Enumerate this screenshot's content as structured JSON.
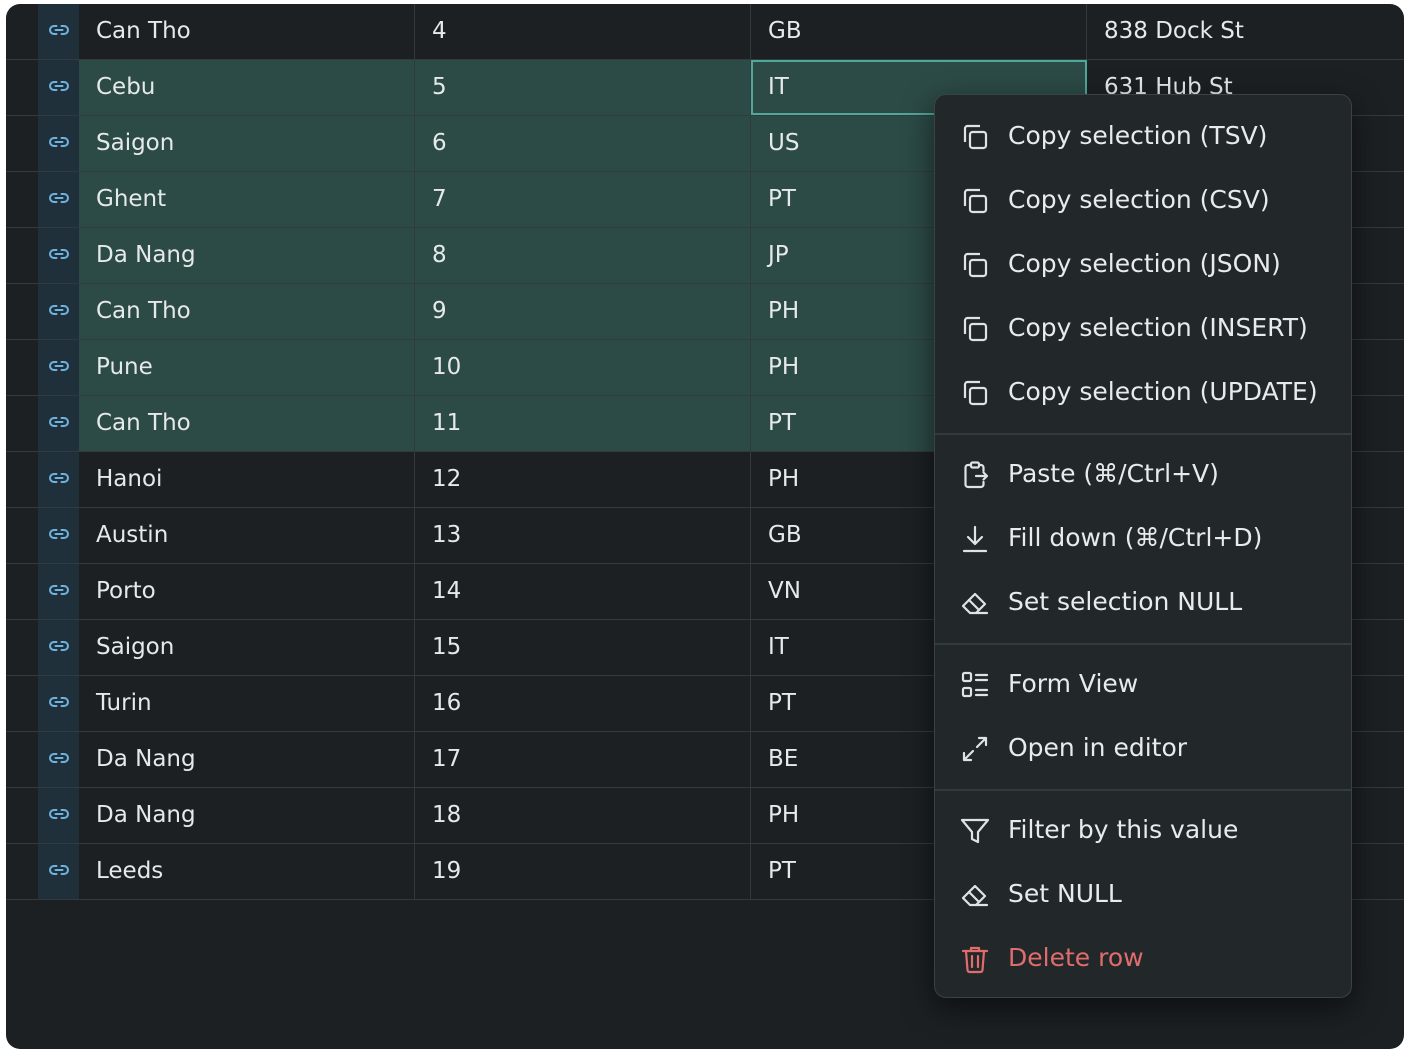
{
  "grid": {
    "rows": [
      {
        "city": "Can Tho",
        "num": "4",
        "code": "GB",
        "address": "838 Dock St",
        "selected": false
      },
      {
        "city": "Cebu",
        "num": "5",
        "code": "IT",
        "address": "631 Hub St",
        "selected": true
      },
      {
        "city": "Saigon",
        "num": "6",
        "code": "US",
        "address": "",
        "selected": true
      },
      {
        "city": "Ghent",
        "num": "7",
        "code": "PT",
        "address": "",
        "selected": true
      },
      {
        "city": "Da Nang",
        "num": "8",
        "code": "JP",
        "address": "",
        "selected": true
      },
      {
        "city": "Can Tho",
        "num": "9",
        "code": "PH",
        "address": "",
        "selected": true
      },
      {
        "city": "Pune",
        "num": "10",
        "code": "PH",
        "address": "",
        "selected": true
      },
      {
        "city": "Can Tho",
        "num": "11",
        "code": "PT",
        "address": "",
        "selected": true
      },
      {
        "city": "Hanoi",
        "num": "12",
        "code": "PH",
        "address": "",
        "selected": false
      },
      {
        "city": "Austin",
        "num": "13",
        "code": "GB",
        "address": "",
        "selected": false
      },
      {
        "city": "Porto",
        "num": "14",
        "code": "VN",
        "address": "",
        "selected": false
      },
      {
        "city": "Saigon",
        "num": "15",
        "code": "IT",
        "address": "",
        "selected": false
      },
      {
        "city": "Turin",
        "num": "16",
        "code": "PT",
        "address": "",
        "selected": false
      },
      {
        "city": "Da Nang",
        "num": "17",
        "code": "BE",
        "address": "",
        "selected": false
      },
      {
        "city": "Da Nang",
        "num": "18",
        "code": "PH",
        "address": "",
        "selected": false
      },
      {
        "city": "Leeds",
        "num": "19",
        "code": "PT",
        "address": "",
        "selected": false
      }
    ]
  },
  "context_menu": {
    "copy_tsv": "Copy selection (TSV)",
    "copy_csv": "Copy selection (CSV)",
    "copy_json": "Copy selection (JSON)",
    "copy_insert": "Copy selection (INSERT)",
    "copy_update": "Copy selection (UPDATE)",
    "paste": "Paste (⌘/Ctrl+V)",
    "fill_down": "Fill down (⌘/Ctrl+D)",
    "set_selection_null": "Set selection NULL",
    "form_view": "Form View",
    "open_in_editor": "Open in editor",
    "filter_by_value": "Filter by this value",
    "set_null": "Set NULL",
    "delete_row": "Delete row"
  },
  "colors": {
    "background": "#1c2022",
    "selection": "#2c4a46",
    "focus_outline": "#4fa89a",
    "link_icon": "#6fb3e0",
    "danger": "#e06c6c"
  },
  "icons": {
    "row_link": "link-icon",
    "copy": "copy-icon",
    "paste": "paste-icon",
    "fill_down": "arrow-down-icon",
    "set_null": "eraser-icon",
    "form_view": "form-list-icon",
    "open_editor": "expand-icon",
    "filter": "filter-icon",
    "delete": "trash-icon"
  }
}
